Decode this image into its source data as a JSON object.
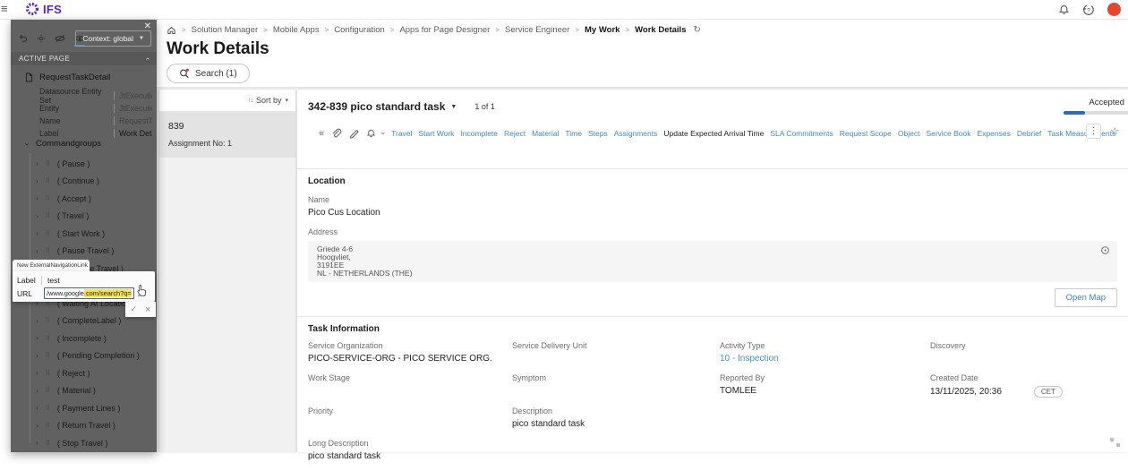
{
  "topbar": {
    "brand": "IFS"
  },
  "breadcrumb": {
    "items": [
      "Solution Manager",
      "Mobile Apps",
      "Configuration",
      "Apps for Page Designer",
      "Service Engineer",
      "My Work",
      "Work Details"
    ]
  },
  "page": {
    "title": "Work Details",
    "search_label": "Search (1)"
  },
  "sidebar": {
    "context_label": "Context: global",
    "section_title": "ACTIVE PAGE",
    "page_node": "RequestTaskDetail",
    "properties": [
      {
        "label": "Datasource Entity Set",
        "value": "JtExecutionIn..."
      },
      {
        "label": "Entity",
        "value": "JtExecutionIn..."
      },
      {
        "label": "Name",
        "value": "RequestTask..."
      },
      {
        "label": "Label",
        "value": "Work Details"
      }
    ],
    "group_label": "Commandgroups",
    "commands": [
      "( Pause )",
      "( Continue )",
      "( Accept )",
      "( Travel )",
      "( Start Work )",
      "( Pause Travel )",
      "( Continue Travel )",
      "",
      "( Waiting At Location )",
      "( CompleteLabel )",
      "( Incomplete )",
      "( Pending Completion )",
      "( Reject )",
      "( Material )",
      "( Payment Lines )",
      "( Return Travel )",
      "( Stop Travel )"
    ]
  },
  "popup": {
    "title": "New ExternalNavigationLink",
    "label_label": "Label",
    "label_value": "test",
    "url_label": "URL",
    "url_prefix": "/www.google",
    "url_highlight": ".com/search?q=",
    "confirm": "✓",
    "cancel": "×"
  },
  "list_panel": {
    "sort_label": "Sort by",
    "item_title": "839",
    "item_subtitle": "Assignment No: 1"
  },
  "task": {
    "title": "342-839 pico standard task",
    "pager": "1 of 1",
    "status": "Accepted",
    "toolbar": [
      "Travel",
      "Start Work",
      "Incomplete",
      "Reject",
      "Material",
      "Time",
      "Steps",
      "Assignments",
      "Update Expected Arrival Time",
      "SLA Commitments",
      "Request Scope",
      "Object",
      "Service Book",
      "Expenses",
      "Debrief",
      "Task Measurements"
    ],
    "location": {
      "section_title": "Location",
      "name_label": "Name",
      "name_value": "Pico Cus Location",
      "address_label": "Address",
      "address_lines": [
        "Griede 4-6",
        "Hoogvliet,",
        "3191EE",
        "NL - NETHERLANDS (THE)"
      ],
      "open_map": "Open Map"
    },
    "info": {
      "section_title": "Task Information",
      "fields": [
        {
          "label": "Service Organization",
          "value": "PICO-SERVICE-ORG - PICO SERVICE ORG."
        },
        {
          "label": "Service Delivery Unit",
          "value": ""
        },
        {
          "label": "Activity Type",
          "value": "10 - Inspection"
        },
        {
          "label": "Discovery",
          "value": ""
        },
        {
          "label": "Work Stage",
          "value": ""
        },
        {
          "label": "Symptom",
          "value": ""
        },
        {
          "label": "Reported By",
          "value": "TOMLEE"
        },
        {
          "label": "Created Date",
          "value": "13/11/2025, 20:36",
          "badge": "CET"
        },
        {
          "label": "Priority",
          "value": ""
        },
        {
          "label": "Description",
          "value": "pico standard task"
        },
        {
          "label": "Long Description",
          "value": "pico standard task"
        }
      ]
    }
  },
  "colors": {
    "accent_blue": "#4287c6",
    "brand_purple": "#5a24d6",
    "highlight_yellow": "#f7e34f",
    "status_fill": "#2f6bb4",
    "avatar_red": "#e8442e"
  }
}
